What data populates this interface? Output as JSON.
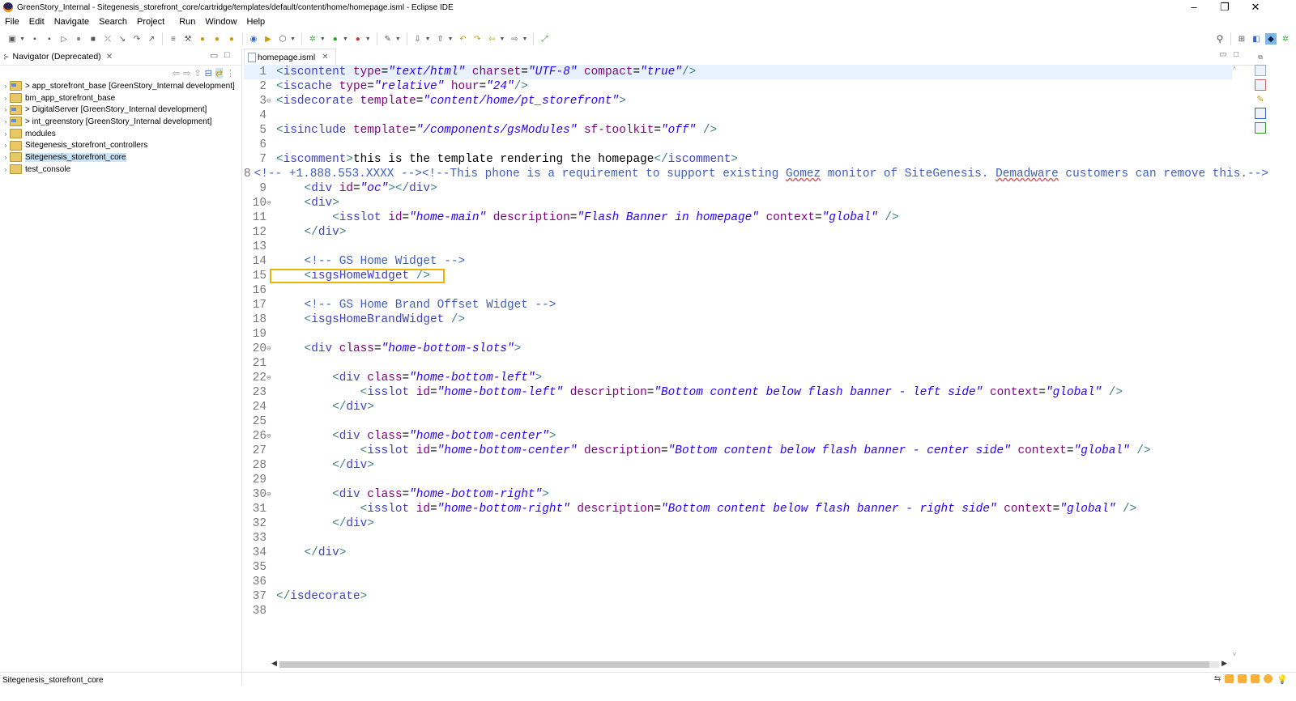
{
  "window": {
    "title": "GreenStory_Internal - Sitegenesis_storefront_core/cartridge/templates/default/content/home/homepage.isml - Eclipse IDE",
    "controls": [
      "–",
      "❐",
      "✕"
    ]
  },
  "menu": [
    "File",
    "Edit",
    "Navigate",
    "Search",
    "Project",
    "Run",
    "Window",
    "Help"
  ],
  "navigator": {
    "tab_label": "Navigator (Deprecated)",
    "close": "✕",
    "items": [
      {
        "label": "> app_storefront_base [GreenStory_Internal development]",
        "selected": false
      },
      {
        "label": "bm_app_storefront_base",
        "selected": false
      },
      {
        "label": "> DigitalServer [GreenStory_Internal development]",
        "selected": false
      },
      {
        "label": "> int_greenstory [GreenStory_Internal development]",
        "selected": false
      },
      {
        "label": "modules",
        "selected": false
      },
      {
        "label": "Sitegenesis_storefront_controllers",
        "selected": false
      },
      {
        "label": "Sitegenesis_storefront_core",
        "selected": true
      },
      {
        "label": "test_console",
        "selected": false
      }
    ]
  },
  "editor": {
    "tab_label": "homepage.isml",
    "close": "✕",
    "highlighted_line": 15
  },
  "code_lines": [
    {
      "n": "1",
      "fold": "",
      "segs": [
        [
          "tag",
          "<"
        ],
        [
          "tagname",
          "iscontent"
        ],
        [
          "plain",
          " "
        ],
        [
          "attr",
          "type"
        ],
        [
          "plain",
          "="
        ],
        [
          "val",
          "\"text/html\""
        ],
        [
          "plain",
          " "
        ],
        [
          "attr",
          "charset"
        ],
        [
          "plain",
          "="
        ],
        [
          "val",
          "\"UTF-8\""
        ],
        [
          "plain",
          " "
        ],
        [
          "attr",
          "compact"
        ],
        [
          "plain",
          "="
        ],
        [
          "val",
          "\"true\""
        ],
        [
          "tag",
          "/>"
        ]
      ]
    },
    {
      "n": "2",
      "fold": "",
      "segs": [
        [
          "tag",
          "<"
        ],
        [
          "tagname",
          "iscache"
        ],
        [
          "plain",
          " "
        ],
        [
          "attr",
          "type"
        ],
        [
          "plain",
          "="
        ],
        [
          "val",
          "\"relative\""
        ],
        [
          "plain",
          " "
        ],
        [
          "attr",
          "hour"
        ],
        [
          "plain",
          "="
        ],
        [
          "val",
          "\"24\""
        ],
        [
          "tag",
          "/>"
        ]
      ]
    },
    {
      "n": "3",
      "fold": "⊖",
      "segs": [
        [
          "tag",
          "<"
        ],
        [
          "tagname",
          "isdecorate"
        ],
        [
          "plain",
          " "
        ],
        [
          "attr",
          "template"
        ],
        [
          "plain",
          "="
        ],
        [
          "val",
          "\"content/home/pt_storefront\""
        ],
        [
          "tag",
          ">"
        ]
      ]
    },
    {
      "n": "4",
      "fold": "",
      "segs": []
    },
    {
      "n": "5",
      "fold": "",
      "segs": [
        [
          "tag",
          "<"
        ],
        [
          "tagname",
          "isinclude"
        ],
        [
          "plain",
          " "
        ],
        [
          "attr",
          "template"
        ],
        [
          "plain",
          "="
        ],
        [
          "val",
          "\"/components/gsModules\""
        ],
        [
          "plain",
          " "
        ],
        [
          "attr",
          "sf-toolkit"
        ],
        [
          "plain",
          "="
        ],
        [
          "val",
          "\"off\""
        ],
        [
          "plain",
          " "
        ],
        [
          "tag",
          "/>"
        ]
      ]
    },
    {
      "n": "6",
      "fold": "",
      "segs": []
    },
    {
      "n": "7",
      "fold": "",
      "segs": [
        [
          "tag",
          "<"
        ],
        [
          "tagname",
          "iscomment"
        ],
        [
          "tag",
          ">"
        ],
        [
          "plain",
          "this is the template rendering the homepage"
        ],
        [
          "tag",
          "</"
        ],
        [
          "tagname",
          "iscomment"
        ],
        [
          "tag",
          ">"
        ]
      ]
    },
    {
      "n": "8",
      "fold": "",
      "segs": [
        [
          "cmt",
          "<!-- +1.888.553.XXXX --><!--This phone is a requirement to support existing "
        ],
        [
          "cmtsq",
          "Gomez"
        ],
        [
          "cmt",
          " monitor of SiteGenesis. "
        ],
        [
          "cmtsq",
          "Demadware"
        ],
        [
          "cmt",
          " customers can remove this.-->"
        ]
      ]
    },
    {
      "n": "9",
      "fold": "",
      "segs": [
        [
          "plain",
          "    "
        ],
        [
          "tag",
          "<"
        ],
        [
          "tagname",
          "div"
        ],
        [
          "plain",
          " "
        ],
        [
          "attr",
          "id"
        ],
        [
          "plain",
          "="
        ],
        [
          "val",
          "\"oc\""
        ],
        [
          "tag",
          "></"
        ],
        [
          "tagname",
          "div"
        ],
        [
          "tag",
          ">"
        ]
      ]
    },
    {
      "n": "10",
      "fold": "⊖",
      "segs": [
        [
          "plain",
          "    "
        ],
        [
          "tag",
          "<"
        ],
        [
          "tagname",
          "div"
        ],
        [
          "tag",
          ">"
        ]
      ]
    },
    {
      "n": "11",
      "fold": "",
      "segs": [
        [
          "plain",
          "        "
        ],
        [
          "tag",
          "<"
        ],
        [
          "tagname",
          "isslot"
        ],
        [
          "plain",
          " "
        ],
        [
          "attr",
          "id"
        ],
        [
          "plain",
          "="
        ],
        [
          "val",
          "\"home-main\""
        ],
        [
          "plain",
          " "
        ],
        [
          "attr",
          "description"
        ],
        [
          "plain",
          "="
        ],
        [
          "val",
          "\"Flash Banner in homepage\""
        ],
        [
          "plain",
          " "
        ],
        [
          "attr",
          "context"
        ],
        [
          "plain",
          "="
        ],
        [
          "val",
          "\"global\""
        ],
        [
          "plain",
          " "
        ],
        [
          "tag",
          "/>"
        ]
      ]
    },
    {
      "n": "12",
      "fold": "",
      "segs": [
        [
          "plain",
          "    "
        ],
        [
          "tag",
          "</"
        ],
        [
          "tagname",
          "div"
        ],
        [
          "tag",
          ">"
        ]
      ]
    },
    {
      "n": "13",
      "fold": "",
      "segs": []
    },
    {
      "n": "14",
      "fold": "",
      "segs": [
        [
          "plain",
          "    "
        ],
        [
          "cmt",
          "<!-- GS Home Widget -->"
        ]
      ]
    },
    {
      "n": "15",
      "fold": "",
      "segs": [
        [
          "plain",
          "    "
        ],
        [
          "tag",
          "<"
        ],
        [
          "tagname",
          "isgsHomeWidget"
        ],
        [
          "plain",
          " "
        ],
        [
          "tag",
          "/>"
        ]
      ]
    },
    {
      "n": "16",
      "fold": "",
      "segs": []
    },
    {
      "n": "17",
      "fold": "",
      "segs": [
        [
          "plain",
          "    "
        ],
        [
          "cmt",
          "<!-- GS Home Brand Offset Widget -->"
        ]
      ]
    },
    {
      "n": "18",
      "fold": "",
      "segs": [
        [
          "plain",
          "    "
        ],
        [
          "tag",
          "<"
        ],
        [
          "tagname",
          "isgsHomeBrandWidget"
        ],
        [
          "plain",
          " "
        ],
        [
          "tag",
          "/>"
        ]
      ]
    },
    {
      "n": "19",
      "fold": "",
      "segs": []
    },
    {
      "n": "20",
      "fold": "⊖",
      "segs": [
        [
          "plain",
          "    "
        ],
        [
          "tag",
          "<"
        ],
        [
          "tagname",
          "div"
        ],
        [
          "plain",
          " "
        ],
        [
          "attr",
          "class"
        ],
        [
          "plain",
          "="
        ],
        [
          "val",
          "\"home-bottom-slots\""
        ],
        [
          "tag",
          ">"
        ]
      ]
    },
    {
      "n": "21",
      "fold": "",
      "segs": []
    },
    {
      "n": "22",
      "fold": "⊖",
      "segs": [
        [
          "plain",
          "        "
        ],
        [
          "tag",
          "<"
        ],
        [
          "tagname",
          "div"
        ],
        [
          "plain",
          " "
        ],
        [
          "attr",
          "class"
        ],
        [
          "plain",
          "="
        ],
        [
          "val",
          "\"home-bottom-left\""
        ],
        [
          "tag",
          ">"
        ]
      ]
    },
    {
      "n": "23",
      "fold": "",
      "segs": [
        [
          "plain",
          "            "
        ],
        [
          "tag",
          "<"
        ],
        [
          "tagname",
          "isslot"
        ],
        [
          "plain",
          " "
        ],
        [
          "attr",
          "id"
        ],
        [
          "plain",
          "="
        ],
        [
          "val",
          "\"home-bottom-left\""
        ],
        [
          "plain",
          " "
        ],
        [
          "attr",
          "description"
        ],
        [
          "plain",
          "="
        ],
        [
          "val",
          "\"Bottom content below flash banner - left side\""
        ],
        [
          "plain",
          " "
        ],
        [
          "attr",
          "context"
        ],
        [
          "plain",
          "="
        ],
        [
          "val",
          "\"global\""
        ],
        [
          "plain",
          " "
        ],
        [
          "tag",
          "/>"
        ]
      ]
    },
    {
      "n": "24",
      "fold": "",
      "segs": [
        [
          "plain",
          "        "
        ],
        [
          "tag",
          "</"
        ],
        [
          "tagname",
          "div"
        ],
        [
          "tag",
          ">"
        ]
      ]
    },
    {
      "n": "25",
      "fold": "",
      "segs": []
    },
    {
      "n": "26",
      "fold": "⊖",
      "segs": [
        [
          "plain",
          "        "
        ],
        [
          "tag",
          "<"
        ],
        [
          "tagname",
          "div"
        ],
        [
          "plain",
          " "
        ],
        [
          "attr",
          "class"
        ],
        [
          "plain",
          "="
        ],
        [
          "val",
          "\"home-bottom-center\""
        ],
        [
          "tag",
          ">"
        ]
      ]
    },
    {
      "n": "27",
      "fold": "",
      "segs": [
        [
          "plain",
          "            "
        ],
        [
          "tag",
          "<"
        ],
        [
          "tagname",
          "isslot"
        ],
        [
          "plain",
          " "
        ],
        [
          "attr",
          "id"
        ],
        [
          "plain",
          "="
        ],
        [
          "val",
          "\"home-bottom-center\""
        ],
        [
          "plain",
          " "
        ],
        [
          "attr",
          "description"
        ],
        [
          "plain",
          "="
        ],
        [
          "val",
          "\"Bottom content below flash banner - center side\""
        ],
        [
          "plain",
          " "
        ],
        [
          "attr",
          "context"
        ],
        [
          "plain",
          "="
        ],
        [
          "val",
          "\"global\""
        ],
        [
          "plain",
          " "
        ],
        [
          "tag",
          "/>"
        ]
      ]
    },
    {
      "n": "28",
      "fold": "",
      "segs": [
        [
          "plain",
          "        "
        ],
        [
          "tag",
          "</"
        ],
        [
          "tagname",
          "div"
        ],
        [
          "tag",
          ">"
        ]
      ]
    },
    {
      "n": "29",
      "fold": "",
      "segs": []
    },
    {
      "n": "30",
      "fold": "⊖",
      "segs": [
        [
          "plain",
          "        "
        ],
        [
          "tag",
          "<"
        ],
        [
          "tagname",
          "div"
        ],
        [
          "plain",
          " "
        ],
        [
          "attr",
          "class"
        ],
        [
          "plain",
          "="
        ],
        [
          "val",
          "\"home-bottom-right\""
        ],
        [
          "tag",
          ">"
        ]
      ]
    },
    {
      "n": "31",
      "fold": "",
      "segs": [
        [
          "plain",
          "            "
        ],
        [
          "tag",
          "<"
        ],
        [
          "tagname",
          "isslot"
        ],
        [
          "plain",
          " "
        ],
        [
          "attr",
          "id"
        ],
        [
          "plain",
          "="
        ],
        [
          "val",
          "\"home-bottom-right\""
        ],
        [
          "plain",
          " "
        ],
        [
          "attr",
          "description"
        ],
        [
          "plain",
          "="
        ],
        [
          "val",
          "\"Bottom content below flash banner - right side\""
        ],
        [
          "plain",
          " "
        ],
        [
          "attr",
          "context"
        ],
        [
          "plain",
          "="
        ],
        [
          "val",
          "\"global\""
        ],
        [
          "plain",
          " "
        ],
        [
          "tag",
          "/>"
        ]
      ]
    },
    {
      "n": "32",
      "fold": "",
      "segs": [
        [
          "plain",
          "        "
        ],
        [
          "tag",
          "</"
        ],
        [
          "tagname",
          "div"
        ],
        [
          "tag",
          ">"
        ]
      ]
    },
    {
      "n": "33",
      "fold": "",
      "segs": []
    },
    {
      "n": "34",
      "fold": "",
      "segs": [
        [
          "plain",
          "    "
        ],
        [
          "tag",
          "</"
        ],
        [
          "tagname",
          "div"
        ],
        [
          "tag",
          ">"
        ]
      ]
    },
    {
      "n": "35",
      "fold": "",
      "segs": []
    },
    {
      "n": "36",
      "fold": "",
      "segs": []
    },
    {
      "n": "37",
      "fold": "",
      "segs": [
        [
          "tag",
          "</"
        ],
        [
          "tagname",
          "isdecorate"
        ],
        [
          "tag",
          ">"
        ]
      ]
    },
    {
      "n": "38",
      "fold": "",
      "segs": []
    }
  ],
  "statusbar": {
    "text": "Sitegenesis_storefront_core"
  },
  "colors": {
    "highlight_box": "#f0b400",
    "selection": "#cce4f7",
    "current_line": "#e8f2fe"
  }
}
